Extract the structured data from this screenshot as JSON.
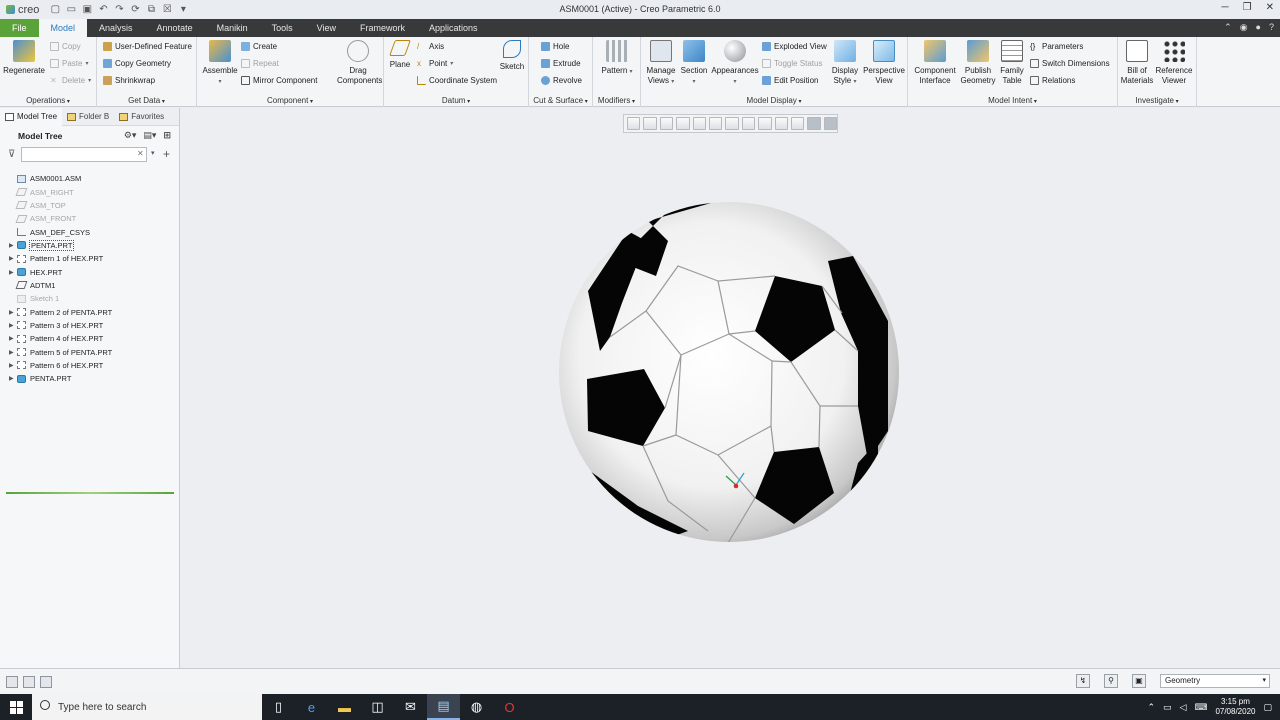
{
  "app": {
    "logo": "creo",
    "window_title": "ASM0001 (Active) - Creo Parametric 6.0"
  },
  "tabs": [
    {
      "label": "File"
    },
    {
      "label": "Model"
    },
    {
      "label": "Analysis"
    },
    {
      "label": "Annotate"
    },
    {
      "label": "Manikin"
    },
    {
      "label": "Tools"
    },
    {
      "label": "View"
    },
    {
      "label": "Framework"
    },
    {
      "label": "Applications"
    }
  ],
  "ribbon": {
    "operations": {
      "label": "Operations",
      "regenerate": "Regenerate",
      "copy": "Copy",
      "paste": "Paste",
      "delete": "Delete"
    },
    "get_data": {
      "label": "Get Data",
      "udf": "User-Defined Feature",
      "copy_geometry": "Copy Geometry",
      "shrinkwrap": "Shrinkwrap"
    },
    "component": {
      "label": "Component",
      "assemble": "Assemble",
      "create": "Create",
      "repeat": "Repeat",
      "mirror": "Mirror Component",
      "drag": "Drag Components"
    },
    "datum": {
      "label": "Datum",
      "plane": "Plane",
      "axis": "Axis",
      "point": "Point",
      "csys": "Coordinate System",
      "sketch": "Sketch"
    },
    "cut_surface": {
      "label": "Cut & Surface",
      "hole": "Hole",
      "extrude": "Extrude",
      "revolve": "Revolve"
    },
    "modifiers": {
      "label": "Modifiers",
      "pattern": "Pattern"
    },
    "model_display": {
      "label": "Model Display",
      "manage_views": "Manage Views",
      "section": "Section",
      "appearances": "Appearances",
      "exploded": "Exploded View",
      "toggle_status": "Toggle Status",
      "edit_position": "Edit Position",
      "display_style": "Display Style",
      "perspective": "Perspective View"
    },
    "model_intent": {
      "label": "Model Intent",
      "component_interface": "Component Interface",
      "publish_geometry": "Publish Geometry",
      "family_table": "Family Table",
      "parameters": "Parameters",
      "switch_dimensions": "Switch Dimensions",
      "relations": "Relations"
    },
    "investigate": {
      "label": "Investigate",
      "bom": "Bill of Materials",
      "reference_viewer": "Reference Viewer"
    }
  },
  "navigator": {
    "tabs": [
      "Model Tree",
      "Folder B",
      "Favorites"
    ],
    "tree_title": "Model Tree",
    "search_value": "",
    "items": [
      {
        "label": "ASM0001.ASM"
      },
      {
        "label": "ASM_RIGHT"
      },
      {
        "label": "ASM_TOP"
      },
      {
        "label": "ASM_FRONT"
      },
      {
        "label": "ASM_DEF_CSYS"
      },
      {
        "label": "PENTA.PRT"
      },
      {
        "label": "Pattern 1 of HEX.PRT"
      },
      {
        "label": "HEX.PRT"
      },
      {
        "label": "ADTM1"
      },
      {
        "label": "Sketch 1"
      },
      {
        "label": "Pattern 2 of PENTA.PRT"
      },
      {
        "label": "Pattern 3 of HEX.PRT"
      },
      {
        "label": "Pattern 4 of HEX.PRT"
      },
      {
        "label": "Pattern 5 of PENTA.PRT"
      },
      {
        "label": "Pattern 6 of HEX.PRT"
      },
      {
        "label": "PENTA.PRT"
      }
    ]
  },
  "statusbar": {
    "filter_value": "Geometry"
  },
  "taskbar": {
    "search_placeholder": "Type here to search",
    "time": "3:15 pm",
    "date": "07/08/2020"
  },
  "colors": {
    "accent": "#5aa338",
    "active_tab_text": "#2b7bbd",
    "dark_bar": "#38393b"
  }
}
